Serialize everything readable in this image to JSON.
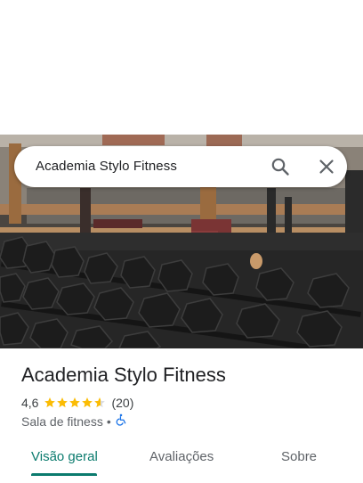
{
  "search": {
    "query": "Academia Stylo Fitness"
  },
  "icons": {
    "search": "search-icon",
    "close": "close-icon",
    "accessibility": "wheelchair-icon",
    "star": "star-icon"
  },
  "place": {
    "name": "Academia Stylo Fitness",
    "rating_value": "4,6",
    "rating": 4.6,
    "review_count": "(20)",
    "category": "Sala de fitness",
    "separator": "•"
  },
  "tabs": [
    {
      "label": "Visão geral",
      "active": true
    },
    {
      "label": "Avaliações",
      "active": false
    },
    {
      "label": "Sobre",
      "active": false
    }
  ],
  "colors": {
    "accent": "#0b7b6e",
    "star": "#fbbc04",
    "star_empty": "#dadce0",
    "accessibility": "#1a73e8"
  }
}
